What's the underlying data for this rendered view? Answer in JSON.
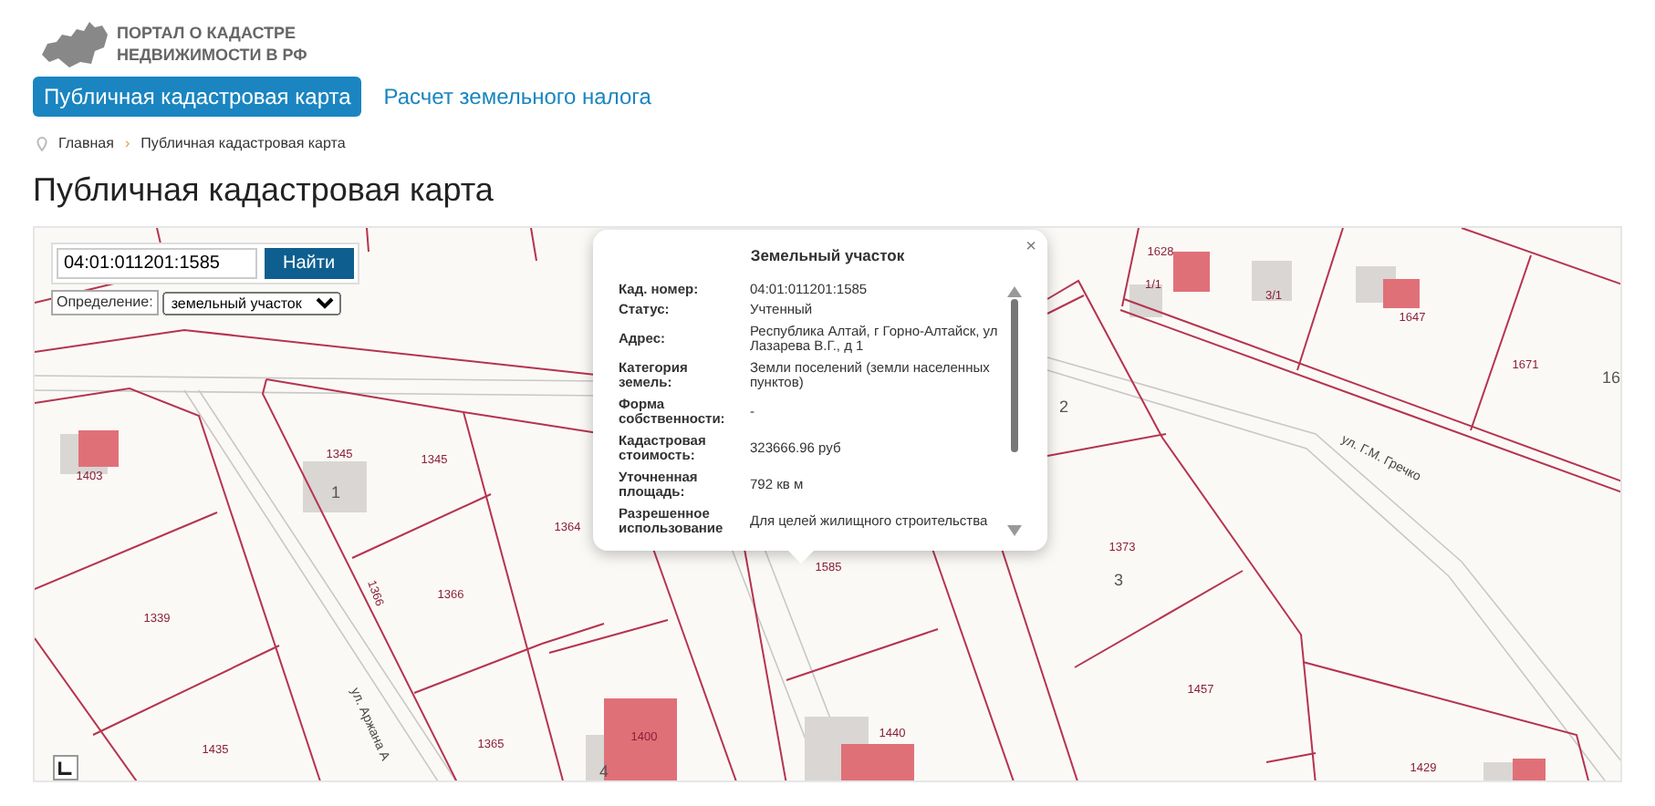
{
  "header": {
    "logo_lines": [
      "ПОРТАЛ О КАДАСТРЕ",
      "НЕДВИЖИМОСТИ В РФ"
    ]
  },
  "tabs": [
    {
      "label": "Публичная кадастровая карта",
      "selected": true
    },
    {
      "label": "Расчет земельного налога",
      "selected": false
    }
  ],
  "breadcrumb": [
    "Главная",
    "Публичная кадастровая карта"
  ],
  "breadcrumb_separator": "›",
  "page_title": "Публичная кадастровая карта",
  "map": {
    "search": {
      "value": "04:01:011201:1585",
      "button": "Найти"
    },
    "definition": {
      "label": "Определение:",
      "value": "земельный участок"
    },
    "labels": [
      "1628",
      "1/1",
      "3/1",
      "1647",
      "1671",
      "16",
      "1403",
      "1345",
      "1",
      "1345",
      "1364",
      "1366",
      "1366",
      "1339",
      "1435",
      "1365",
      "1400",
      "4",
      "1440",
      "1585",
      "1373",
      "3",
      "1457",
      "1429",
      "2"
    ],
    "streets": [
      "ул. Г.М. Гречко",
      "ул. Аржана А"
    ],
    "popup": {
      "title": "Земельный участок",
      "close": "×",
      "rows": [
        {
          "label": "Кад. номер:",
          "value": "04:01:011201:1585"
        },
        {
          "label": "Статус:",
          "value": "Учтенный"
        },
        {
          "label": "Адрес:",
          "value": "Республика Алтай, г Горно-Алтайск, ул Лазарева В.Г., д 1"
        },
        {
          "label": "Категория земель:",
          "value": "Земли поселений (земли населенных пунктов)"
        },
        {
          "label": "Форма собственности:",
          "value": "-"
        },
        {
          "label": "Кадастровая стоимость:",
          "value": "323666.96 руб"
        },
        {
          "label": "Уточненная площадь:",
          "value": "792 кв м"
        },
        {
          "label": "Разрешенное использование",
          "value": "Для целей жилищного строительства"
        }
      ]
    }
  }
}
